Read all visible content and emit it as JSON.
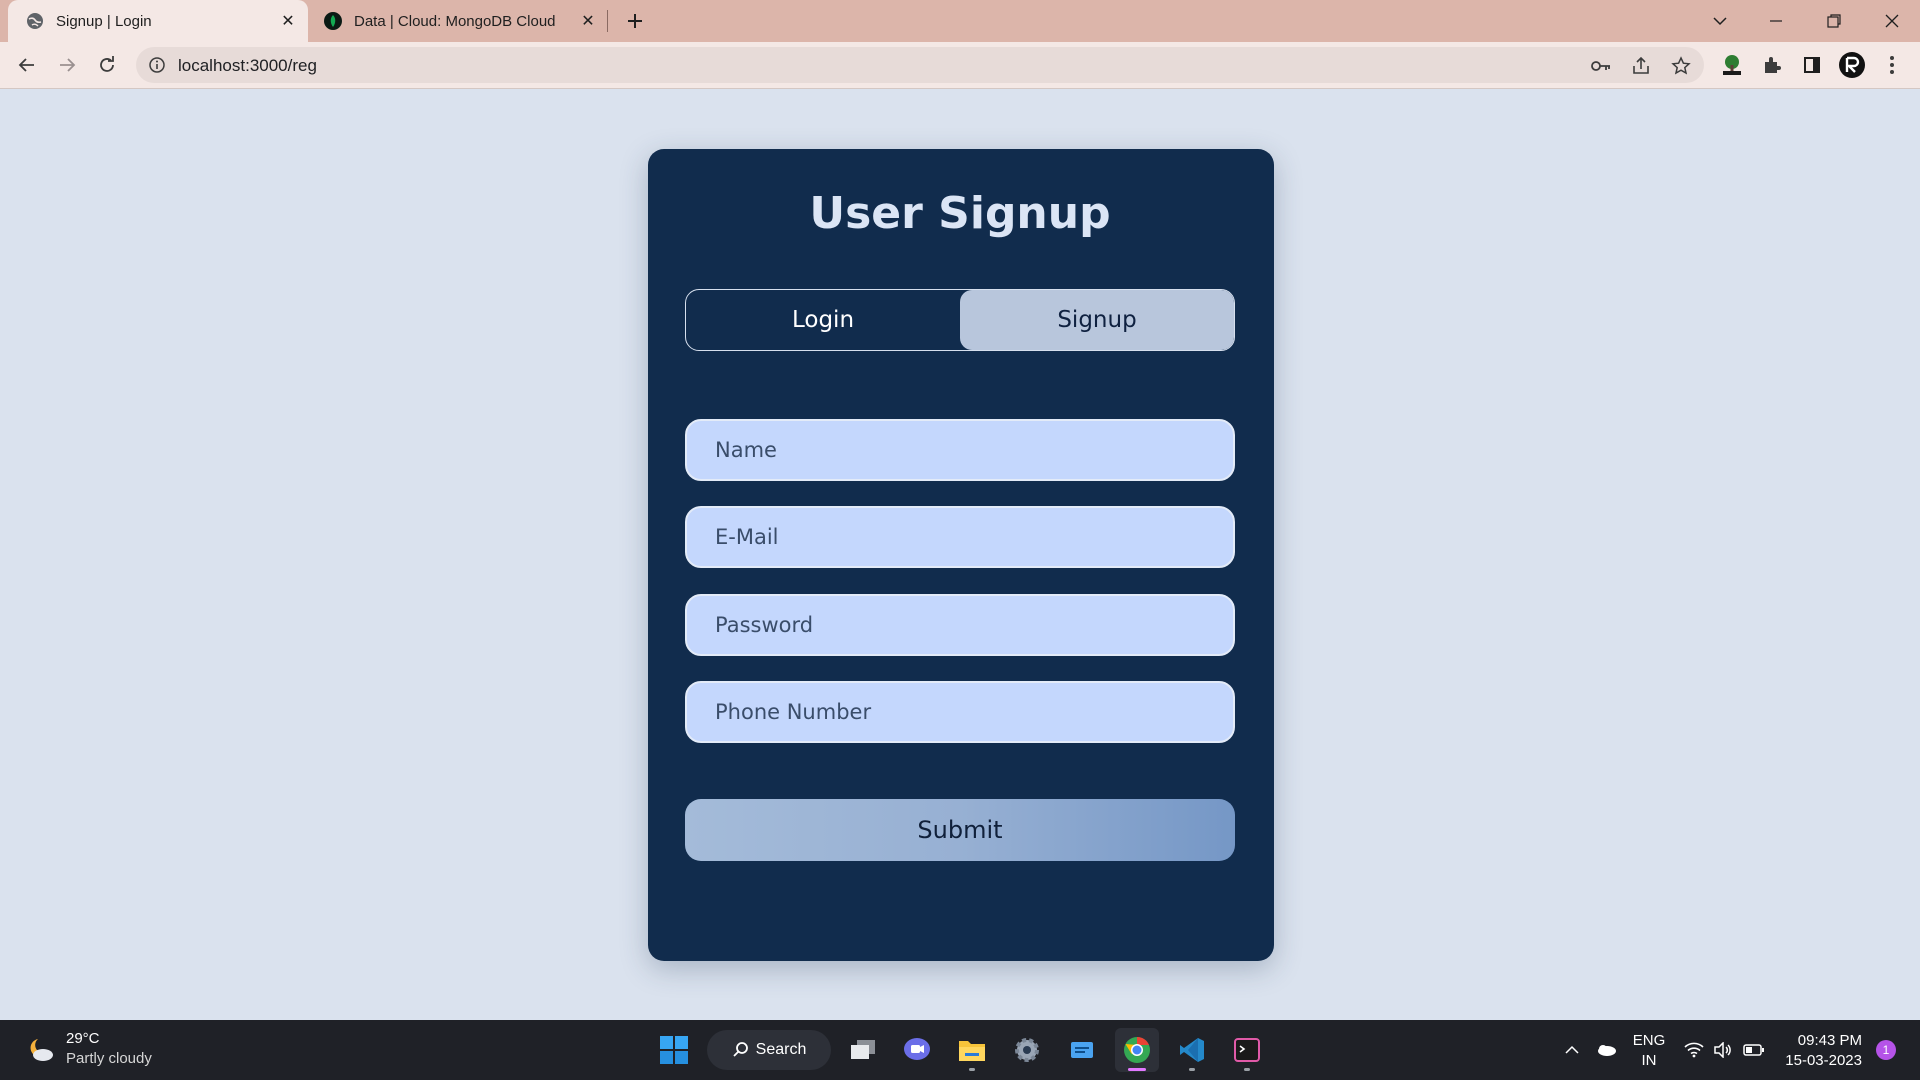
{
  "browser": {
    "tabs": [
      {
        "title": "Signup | Login",
        "active": true,
        "icon": "globe-icon"
      },
      {
        "title": "Data | Cloud: MongoDB Cloud",
        "active": false,
        "icon": "mongodb-leaf-icon"
      }
    ],
    "url": "localhost:3000/reg"
  },
  "page": {
    "title": "User Signup",
    "toggle": {
      "login_label": "Login",
      "signup_label": "Signup",
      "selected": "Signup"
    },
    "fields": {
      "name_placeholder": "Name",
      "email_placeholder": "E-Mail",
      "password_placeholder": "Password",
      "phone_placeholder": "Phone Number"
    },
    "submit_label": "Submit"
  },
  "taskbar": {
    "weather": {
      "temp": "29°C",
      "condition": "Partly cloudy"
    },
    "search_label": "Search",
    "language": {
      "line1": "ENG",
      "line2": "IN"
    },
    "time": "09:43 PM",
    "date": "15-03-2023",
    "notification_count": "1"
  },
  "colors": {
    "page_bg": "#dae2ee",
    "card_bg": "#112c4d",
    "input_bg": "#c4d7fd",
    "toggle_selected_bg": "#b8c6dc",
    "tabstrip_bg": "#dcb5aa"
  }
}
